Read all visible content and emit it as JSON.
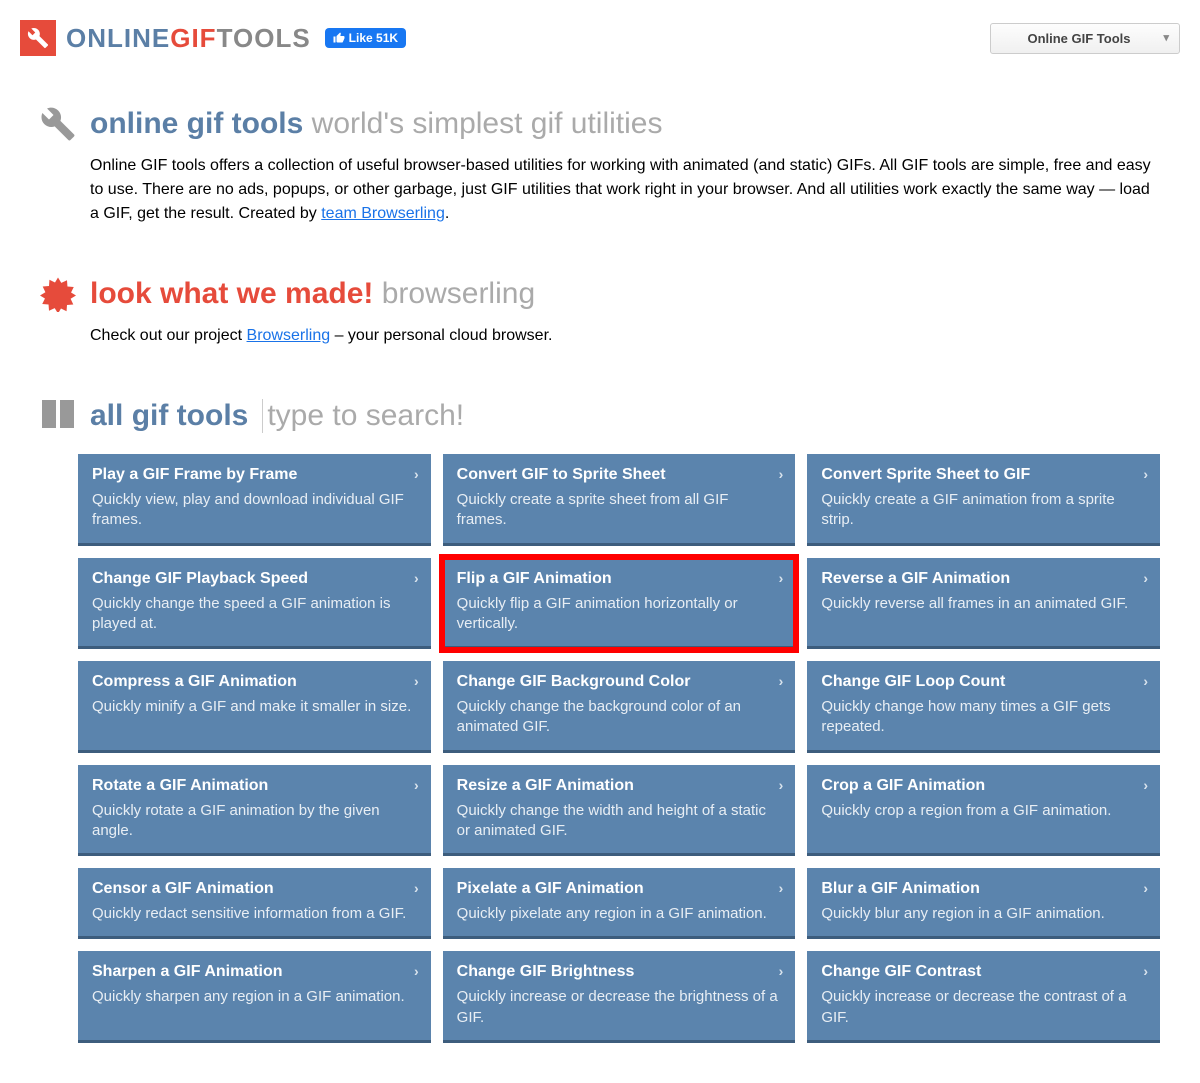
{
  "brand": {
    "p1": "ONLINE",
    "p2": "GIF",
    "p3": "TOOLS"
  },
  "fb": {
    "label": "Like 51K"
  },
  "dropdown": {
    "label": "Online GIF Tools"
  },
  "intro": {
    "titleBlue": "online gif tools",
    "titleGrey": "world's simplest gif utilities",
    "body1": "Online GIF tools offers a collection of useful browser-based utilities for working with animated (and static) GIFs. All GIF tools are simple, free and easy to use. There are no ads, popups, or other garbage, just GIF utilities that work right in your browser. And all utilities work exactly the same way — load a GIF, get the result. Created by ",
    "link": "team Browserling",
    "body2": "."
  },
  "promo": {
    "titleBlue": "look what we made!",
    "titleGrey": "browserling",
    "body1": "Check out our project ",
    "link": "Browserling",
    "body2": " – your personal cloud browser."
  },
  "alltools": {
    "titleBlue": "all gif tools",
    "searchPlaceholder": "type to search!"
  },
  "tools": [
    {
      "title": "Play a GIF Frame by Frame",
      "desc": "Quickly view, play and download individual GIF frames."
    },
    {
      "title": "Convert GIF to Sprite Sheet",
      "desc": "Quickly create a sprite sheet from all GIF frames."
    },
    {
      "title": "Convert Sprite Sheet to GIF",
      "desc": "Quickly create a GIF animation from a sprite strip."
    },
    {
      "title": "Change GIF Playback Speed",
      "desc": "Quickly change the speed a GIF animation is played at."
    },
    {
      "title": "Flip a GIF Animation",
      "desc": "Quickly flip a GIF animation horizontally or vertically.",
      "highlight": true
    },
    {
      "title": "Reverse a GIF Animation",
      "desc": "Quickly reverse all frames in an animated GIF."
    },
    {
      "title": "Compress a GIF Animation",
      "desc": "Quickly minify a GIF and make it smaller in size."
    },
    {
      "title": "Change GIF Background Color",
      "desc": "Quickly change the background color of an animated GIF."
    },
    {
      "title": "Change GIF Loop Count",
      "desc": "Quickly change how many times a GIF gets repeated."
    },
    {
      "title": "Rotate a GIF Animation",
      "desc": "Quickly rotate a GIF animation by the given angle."
    },
    {
      "title": "Resize a GIF Animation",
      "desc": "Quickly change the width and height of a static or animated GIF."
    },
    {
      "title": "Crop a GIF Animation",
      "desc": "Quickly crop a region from a GIF animation."
    },
    {
      "title": "Censor a GIF Animation",
      "desc": "Quickly redact sensitive information from a GIF."
    },
    {
      "title": "Pixelate a GIF Animation",
      "desc": "Quickly pixelate any region in a GIF animation."
    },
    {
      "title": "Blur a GIF Animation",
      "desc": "Quickly blur any region in a GIF animation."
    },
    {
      "title": "Sharpen a GIF Animation",
      "desc": "Quickly sharpen any region in a GIF animation."
    },
    {
      "title": "Change GIF Brightness",
      "desc": "Quickly increase or decrease the brightness of a GIF."
    },
    {
      "title": "Change GIF Contrast",
      "desc": "Quickly increase or decrease the contrast of a GIF."
    }
  ]
}
